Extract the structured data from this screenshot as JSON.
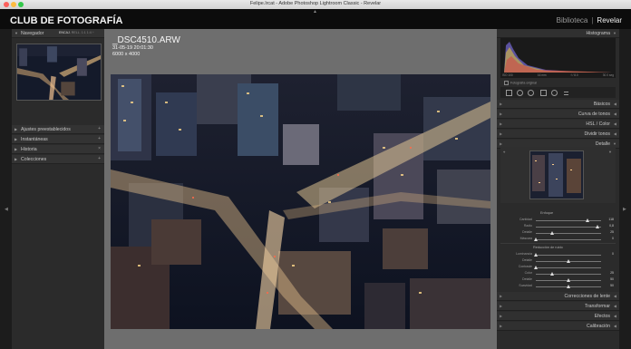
{
  "window": {
    "title": "Felipe.lrcat - Adobe Photoshop Lightroom Classic - Revelar"
  },
  "identity": {
    "brand": "CLUB DE FOTOGRAFÍA",
    "module_library": "Biblioteca",
    "module_sep": "|",
    "module_develop": "Revelar"
  },
  "left_panel": {
    "navigator": {
      "label": "Navegador",
      "opts": [
        "ENCAJ.",
        "RELL.",
        "1:1",
        "1:4 ÷"
      ]
    },
    "sections": [
      {
        "label": "Ajustes preestablecidos"
      },
      {
        "label": "Instantáneas"
      },
      {
        "label": "Historia"
      },
      {
        "label": "Colecciones"
      }
    ]
  },
  "photo_info": {
    "filename": "_DSC4510.ARW",
    "datetime": "31-05-19 20:01:30",
    "dimensions": "6000 x 4000"
  },
  "right_panel": {
    "histogram": {
      "label": "Histograma",
      "values": [
        "ISO 100",
        "16 mm",
        "f / 8.0",
        "30.0 seg"
      ],
      "original_photo": "Fotografía original"
    },
    "sections_top": [
      {
        "label": "Básicos"
      },
      {
        "label": "Curva de tonos"
      },
      {
        "label": "HSL / Color"
      },
      {
        "label": "Dividir tonos"
      },
      {
        "label": "Detalle"
      }
    ],
    "sharpening": {
      "label": "Enfoque",
      "sliders": [
        {
          "label": "Cantidad",
          "value": "118",
          "fraction": 0.79
        },
        {
          "label": "Radio",
          "value": "0,8",
          "fraction": 0.95
        },
        {
          "label": "Detalle",
          "value": "25",
          "fraction": 0.25
        },
        {
          "label": "Máscara",
          "value": "0",
          "fraction": 0.0
        }
      ]
    },
    "noise": {
      "label": "Reducción de ruido",
      "sliders": [
        {
          "label": "Luminancia",
          "value": "0",
          "fraction": 0.0
        },
        {
          "label": "Detalle",
          "value": "",
          "fraction": 0.5
        },
        {
          "label": "Contraste",
          "value": "",
          "fraction": 0.0
        },
        {
          "label": "Color",
          "value": "25",
          "fraction": 0.25
        },
        {
          "label": "Detalle",
          "value": "50",
          "fraction": 0.5
        },
        {
          "label": "Suavidad",
          "value": "50",
          "fraction": 0.5
        }
      ]
    },
    "sections_bottom": [
      {
        "label": "Correcciones de lente"
      },
      {
        "label": "Transformar"
      },
      {
        "label": "Efectos"
      },
      {
        "label": "Calibración"
      }
    ]
  },
  "colors": {
    "accent": "#f0f0f0",
    "panel": "#2b2b2b",
    "background": "#6e6e6e"
  }
}
